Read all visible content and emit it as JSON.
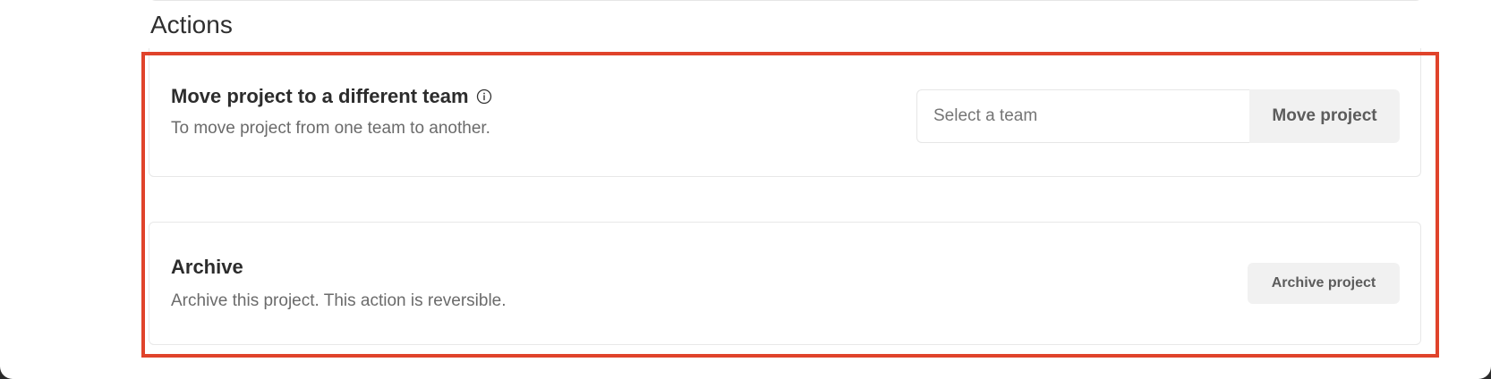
{
  "section": {
    "title": "Actions"
  },
  "move_card": {
    "title": "Move project to a different team",
    "description": "To move project from one team to another.",
    "select_placeholder": "Select a team",
    "button_label": "Move project",
    "info_icon": "info-circle-icon"
  },
  "archive_card": {
    "title": "Archive",
    "description": "Archive this project. This action is reversible.",
    "button_label": "Archive project"
  },
  "colors": {
    "highlight_border": "#e0432b",
    "button_bg": "#f1f1f1"
  }
}
